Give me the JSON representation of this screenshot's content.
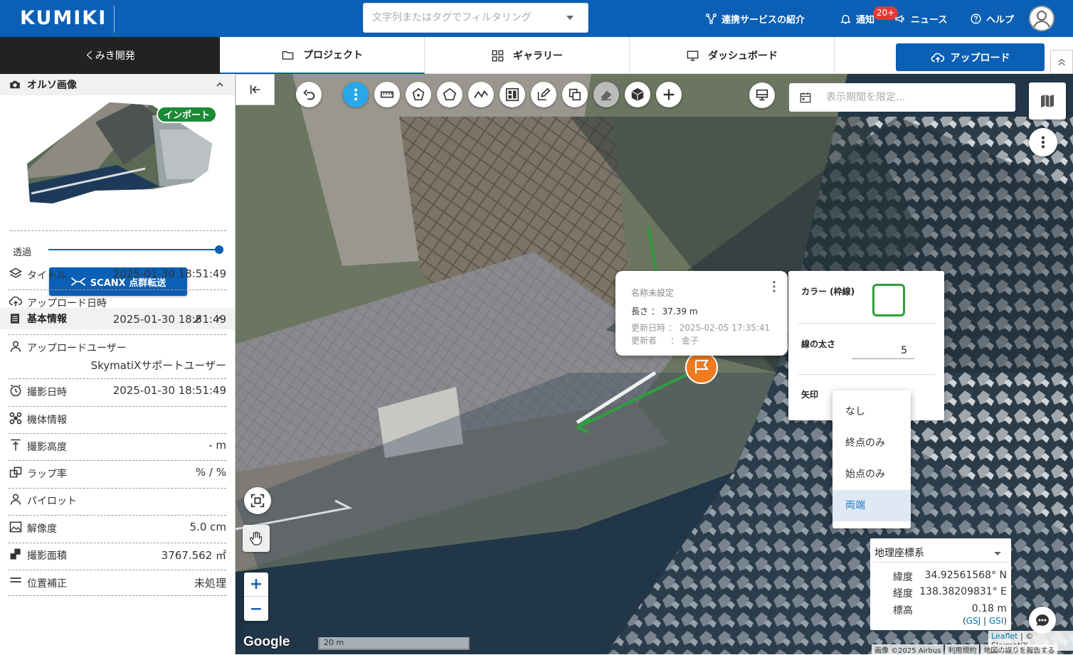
{
  "header": {
    "logo": "KUMIKI",
    "search_placeholder": "文字列またはタグでフィルタリング",
    "nav": {
      "services": "連携サービスの紹介",
      "notify": "通知",
      "notify_badge": "20+",
      "news": "ニュース",
      "help": "ヘルプ"
    }
  },
  "tabs": {
    "project_name": "くみき開発",
    "project": "プロジェクト",
    "gallery": "ギャラリー",
    "dashboard": "ダッシュボード",
    "upload": "アップロード"
  },
  "sidebar": {
    "ortho": {
      "title": "オルソ画像",
      "import_badge": "インポート",
      "opacity_label": "透過",
      "opacity_value": 1.0,
      "scanx_button": "SCANX 点群転送"
    },
    "basic": {
      "title": "基本情報",
      "rows": [
        {
          "icon": "layers-icon",
          "label": "タイトル",
          "value": "2025-01-30 18:51:49"
        },
        {
          "icon": "upload-icon",
          "label": "アップロード日時",
          "value": "2025-01-30 18:51:49"
        },
        {
          "icon": "user-icon",
          "label": "アップロードユーザー",
          "value": "SkymatiXサポートユーザー"
        },
        {
          "icon": "clock-icon",
          "label": "撮影日時",
          "value": "2025-01-30 18:51:49"
        },
        {
          "icon": "drone-icon",
          "label": "機体情報",
          "value": ""
        },
        {
          "icon": "altitude-icon",
          "label": "撮影高度",
          "value": "- m"
        },
        {
          "icon": "overlap-icon",
          "label": "ラップ率",
          "value": "% / %"
        },
        {
          "icon": "pilot-icon",
          "label": "パイロット",
          "value": ""
        },
        {
          "icon": "image-icon",
          "label": "解像度",
          "value": "5.0 cm"
        },
        {
          "icon": "area-icon",
          "label": "撮影面積",
          "value": "3767.562 ㎡"
        },
        {
          "icon": "position-icon",
          "label": "位置補正",
          "value": "未処理"
        }
      ]
    }
  },
  "map": {
    "period_placeholder": "表示期間を限定...",
    "popup": {
      "title": "名称未設定",
      "length_label": "長さ",
      "length_value": "37.39 m",
      "updated_label": "更新日時",
      "updated_value": "2025-02-05 17:35:41",
      "updater_label": "更新者",
      "updater_value": "金子"
    },
    "props": {
      "color_label": "カラー (枠線)",
      "color": "#2e9e3a",
      "width_label": "線の太さ",
      "width_value": "5",
      "arrow_label": "矢印"
    },
    "arrow_options": [
      "なし",
      "終点のみ",
      "始点のみ",
      "両端"
    ],
    "arrow_selected": "両端",
    "coords": {
      "system": "地理座標系",
      "lat_label": "緯度",
      "lat": "34.92561568° N",
      "lng_label": "経度",
      "lng": "138.38209831° E",
      "alt_label": "標高",
      "alt": "0.18 m",
      "gsj": "GSJ",
      "sep": "|",
      "gsi": "GSI"
    },
    "attribution": {
      "leaflet": "Leaflet",
      "skymatix": "| © SkymatiX",
      "imagery": "画像 ©2025 Airbus",
      "terms": "利用規約",
      "report": "地図の誤りを報告する"
    },
    "google": "Google",
    "scale": "20 m",
    "zoom_in": "+",
    "zoom_out": "−"
  }
}
